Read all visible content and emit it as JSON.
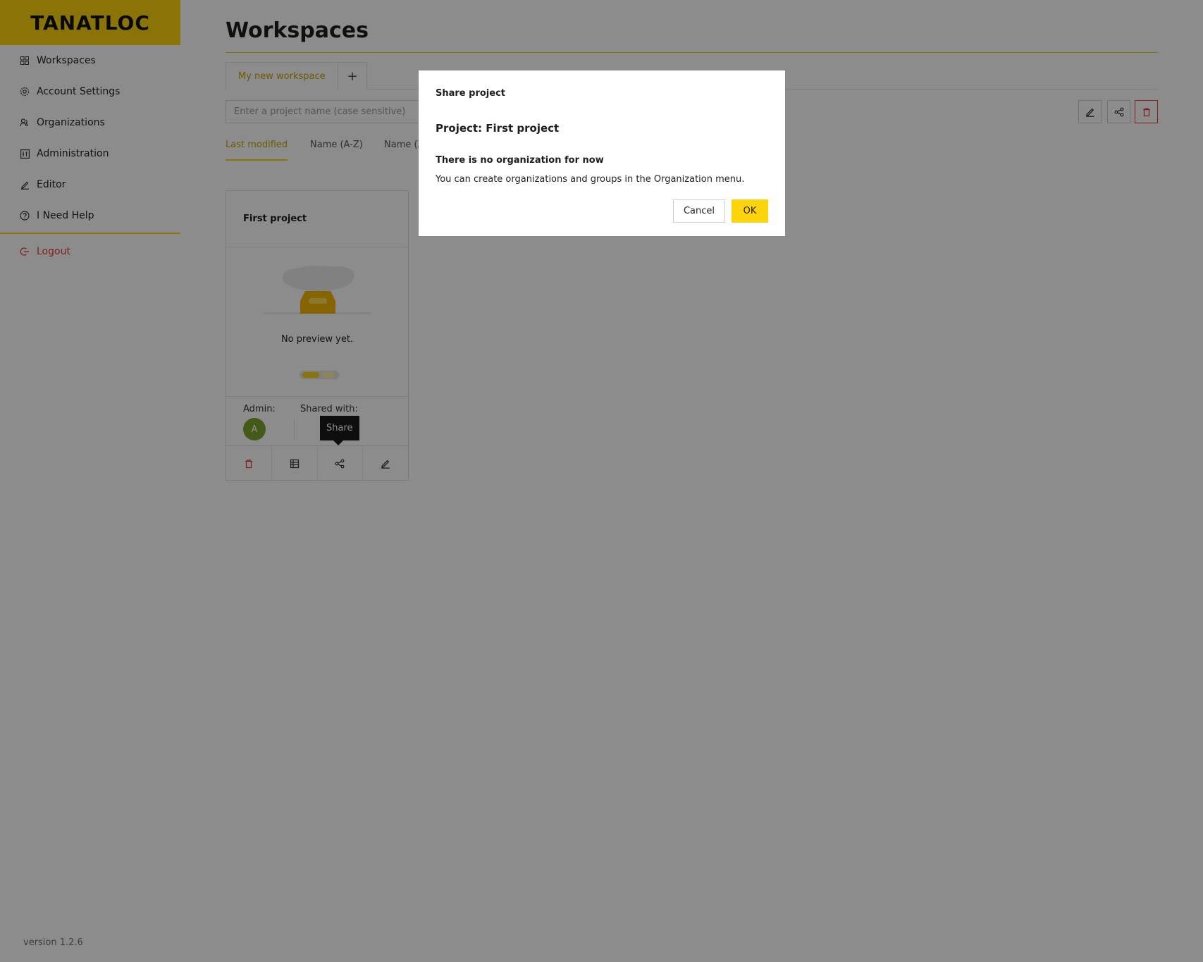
{
  "app": {
    "logo": "TANATLOC",
    "version": "version 1.2.6"
  },
  "sidebar": {
    "items": [
      {
        "label": "Workspaces",
        "icon": "grid-icon"
      },
      {
        "label": "Account Settings",
        "icon": "gear-icon"
      },
      {
        "label": "Organizations",
        "icon": "people-icon"
      },
      {
        "label": "Administration",
        "icon": "admin-icon"
      },
      {
        "label": "Editor",
        "icon": "pencil-icon"
      },
      {
        "label": "I Need Help",
        "icon": "help-icon"
      }
    ],
    "logout": "Logout"
  },
  "main": {
    "title": "Workspaces",
    "workspace_tab": "My new workspace",
    "add_tab": "+",
    "search": {
      "placeholder": "Enter a project name (case sensitive)",
      "value": ""
    },
    "sort_tabs": [
      "Last modified",
      "Name (A-Z)",
      "Name (Z"
    ],
    "active_sort": "Last modified"
  },
  "card": {
    "title": "First project",
    "preview_message": "No preview yet.",
    "admin_label": "Admin:",
    "shared_label": "Shared with:",
    "avatar_initial": "A"
  },
  "tooltip": "Share",
  "modal": {
    "header": "Share project",
    "project_line": "Project: First project",
    "notice_title": "There is no organization for now",
    "notice_text": "You can create organizations and groups in the Organization menu.",
    "cancel": "Cancel",
    "ok": "OK"
  },
  "colors": {
    "accent": "#fdd30d",
    "danger": "#e53935",
    "avatar": "#7ba52c"
  }
}
